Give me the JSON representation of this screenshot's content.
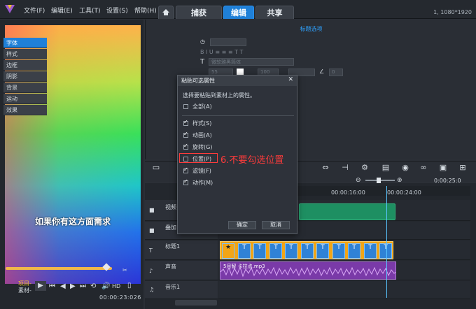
{
  "menu": {
    "file": "文件(F)",
    "edit": "编辑(E)",
    "tools": "工具(T)",
    "settings": "设置(S)",
    "help": "帮助(H)"
  },
  "tabs": {
    "capture": "捕获",
    "edit": "编辑",
    "share": "共享",
    "active": "编辑"
  },
  "resolution": "1, 1080*1920",
  "preview": {
    "caption": "如果你有这方面需求",
    "project_label": "项目-",
    "clip_label": "素材-",
    "hd": "HD",
    "timecode": "00:00:23:026"
  },
  "options_panel": {
    "title": "标题选项",
    "side_tabs": [
      "字体",
      "样式",
      "边框",
      "阴影",
      "背景",
      "运动",
      "效果"
    ],
    "active_side_tab": "字体",
    "font_name": "微软雅黑简体",
    "font_size": "55",
    "line_spacing": "100",
    "rotation": "0"
  },
  "dialog": {
    "title": "粘贴可选属性",
    "description": "选择要粘贴到素材上的属性。",
    "select_all": "全部(A)",
    "options": [
      {
        "label": "样式(S)",
        "checked": true
      },
      {
        "label": "动画(A)",
        "checked": true
      },
      {
        "label": "旋转(G)",
        "checked": true
      },
      {
        "label": "位置(P)",
        "checked": false
      },
      {
        "label": "滤镜(F)",
        "checked": true
      },
      {
        "label": "动作(M)",
        "checked": true
      }
    ],
    "ok": "确定",
    "cancel": "取消"
  },
  "annotation": "6.不要勾选位置",
  "timeline": {
    "ruler": [
      "00:00:16:00",
      "00:00:24:00"
    ],
    "timecode_right": "0:00:25:0",
    "tracks": [
      {
        "name": "视频"
      },
      {
        "name": "叠加"
      },
      {
        "name": "标题1"
      },
      {
        "name": "声音"
      },
      {
        "name": "音乐1"
      }
    ],
    "audio_clip_label": "5月智 卡拉点.mp3"
  },
  "colors": {
    "accent": "#1f80d8",
    "annotation": "#ff3b3b",
    "title_clip": "#f2a516",
    "video_clip": "#1e8f62",
    "audio_clip": "#7a3aa8"
  }
}
